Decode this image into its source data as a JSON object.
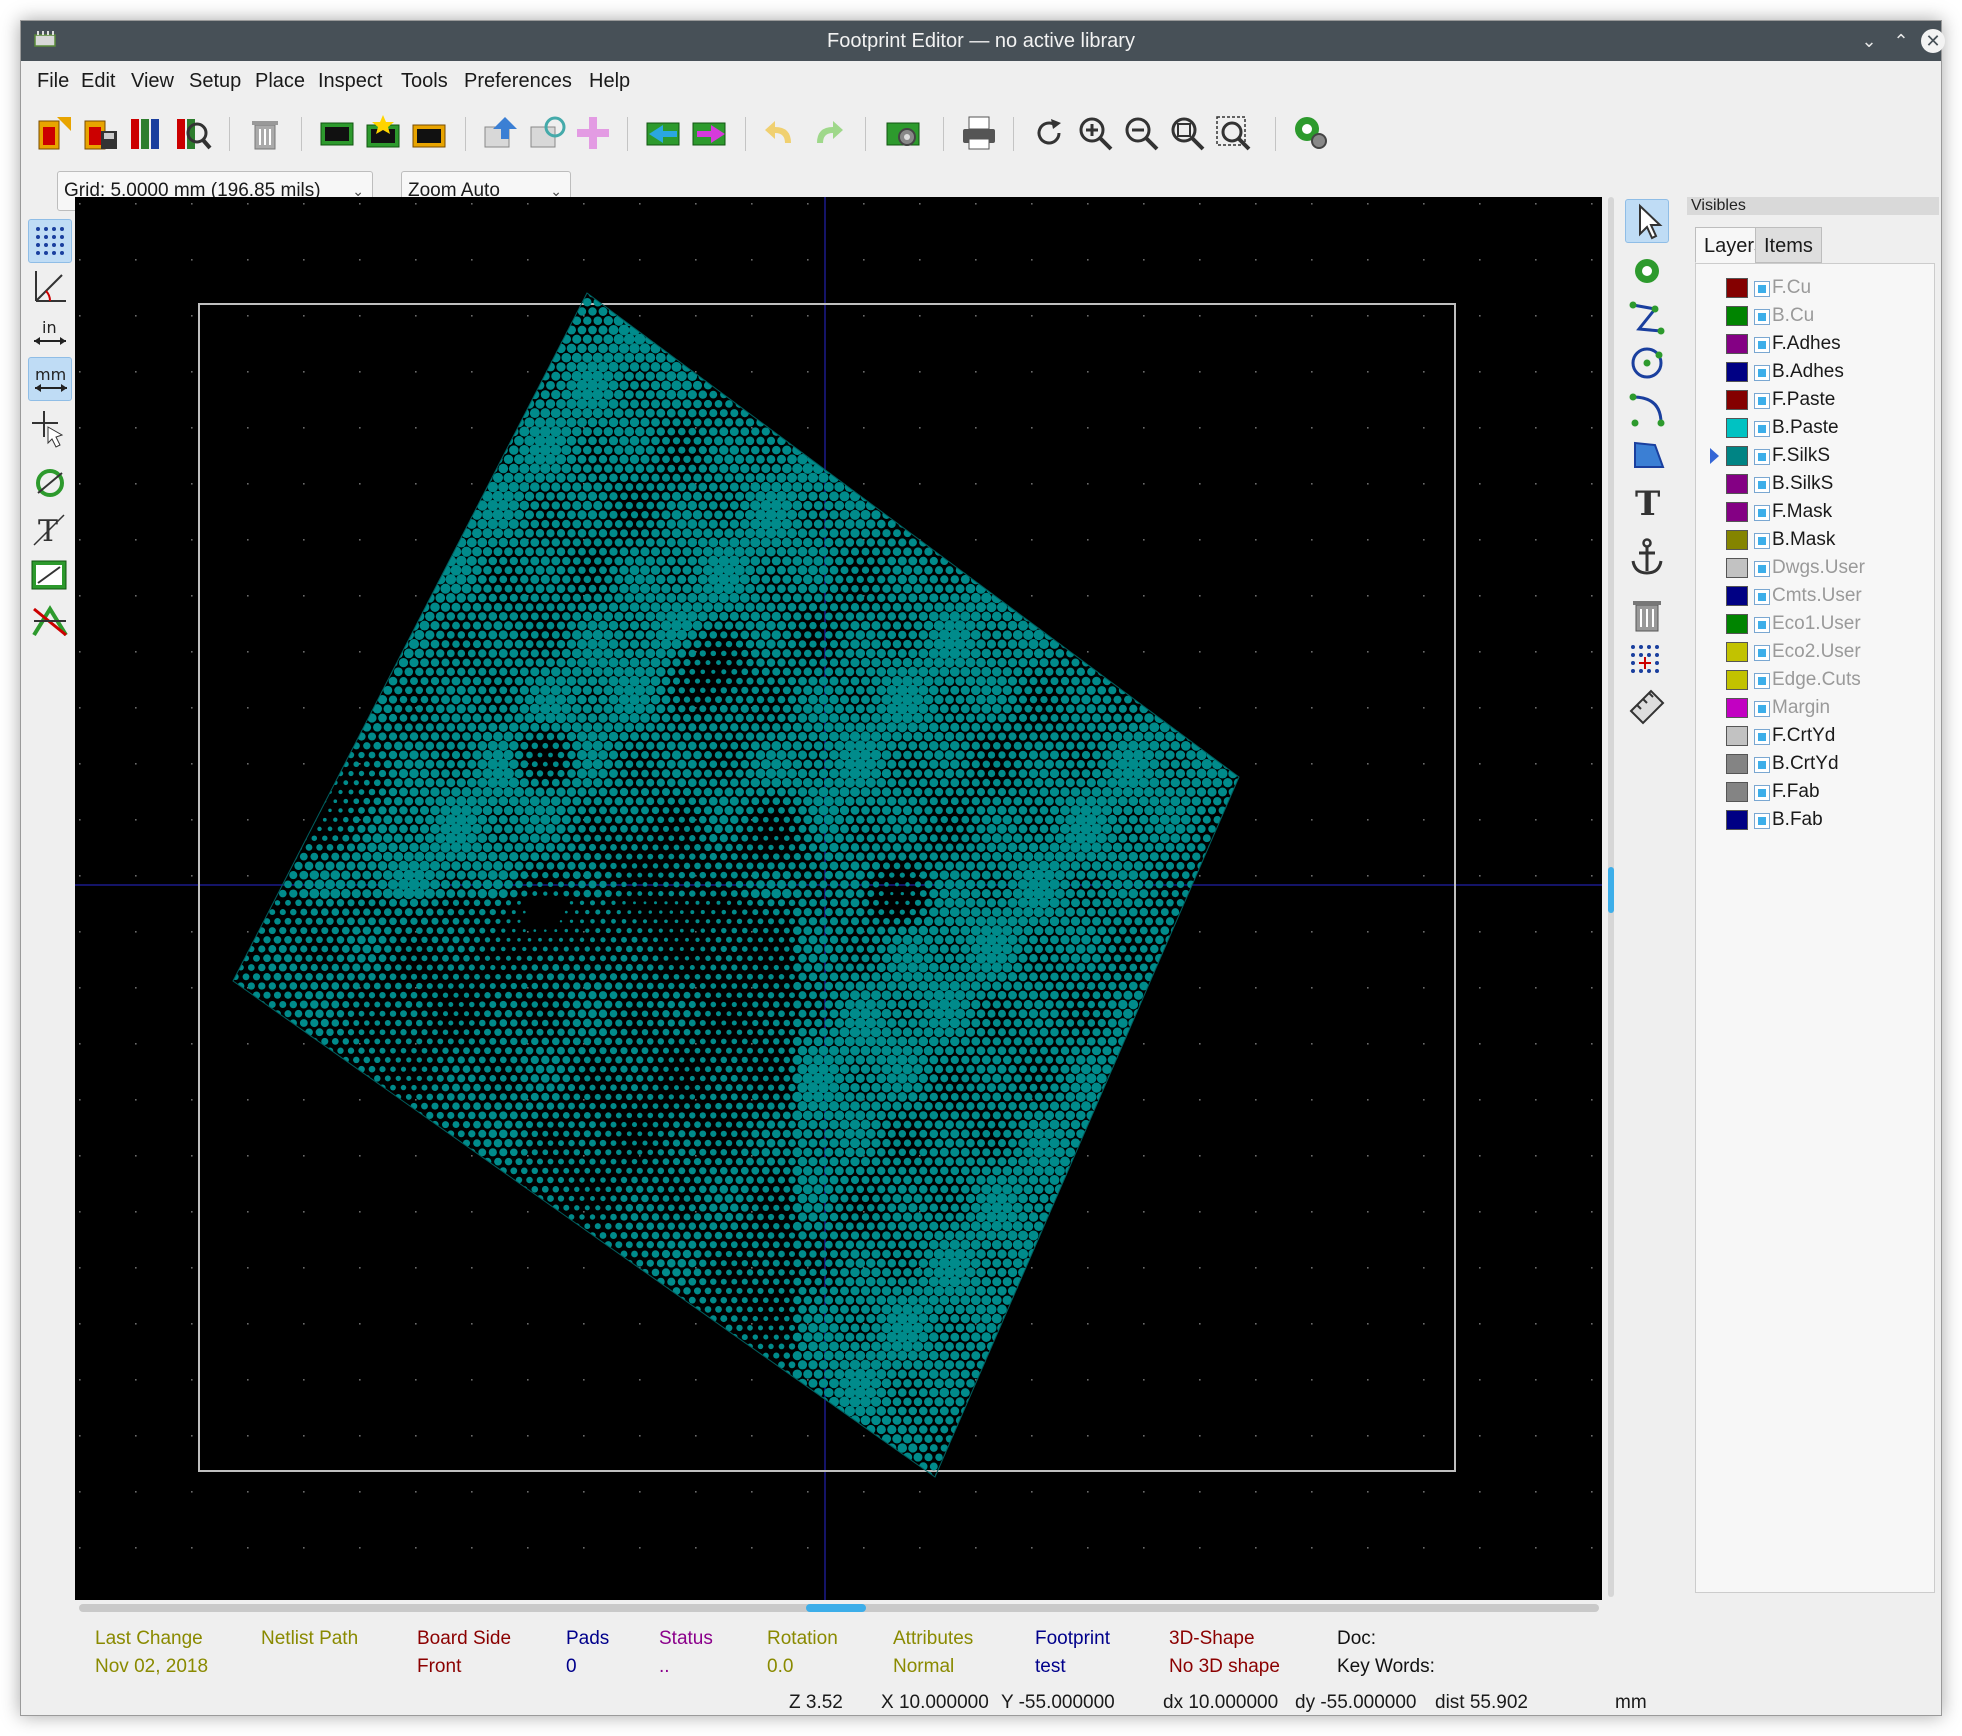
{
  "window": {
    "title": "Footprint Editor — no active library"
  },
  "menubar": {
    "items": [
      "File",
      "Edit",
      "View",
      "Setup",
      "Place",
      "Inspect",
      "Tools",
      "Preferences",
      "Help"
    ]
  },
  "toolbar": {
    "icons": [
      "new-footprint-icon",
      "save-footprint-icon",
      "library-browser-icon",
      "inspect-library-icon",
      "delete-icon",
      "load-from-board-icon",
      "insert-into-board-icon",
      "load-footprint-icon",
      "import-icon",
      "footprint-wizard-icon",
      "add-pad-icon",
      "load-module-icon",
      "update-board-icon",
      "undo-icon",
      "redo-icon",
      "footprint-properties-icon",
      "print-icon",
      "redraw-icon",
      "zoom-in-icon",
      "zoom-out-icon",
      "zoom-fit-icon",
      "zoom-selection-icon",
      "3d-viewer-icon"
    ]
  },
  "toolbar2": {
    "grid_label": "Grid: 5.0000 mm (196.85 mils)",
    "zoom_label": "Zoom Auto"
  },
  "left_toolbar": {
    "icons": [
      "grid-icon",
      "polar-coords-icon",
      "inch-units-icon",
      "mm-units-icon",
      "cursor-shape-icon",
      "pad-sketch-icon",
      "text-sketch-icon",
      "graphic-sketch-icon",
      "high-contrast-icon"
    ]
  },
  "right_toolbar": {
    "icons": [
      "select-arrow-icon",
      "add-pad-icon",
      "add-line-icon",
      "add-circle-icon",
      "add-arc-icon",
      "add-polygon-icon",
      "add-text-icon",
      "anchor-icon",
      "delete-tool-icon",
      "grid-origin-icon",
      "measure-icon"
    ]
  },
  "panel": {
    "title": "Visibles",
    "tabs": [
      "Layers",
      "Items"
    ],
    "layers": [
      {
        "name": "F.Cu",
        "color": "#840000",
        "dim": true
      },
      {
        "name": "B.Cu",
        "color": "#008400",
        "dim": true
      },
      {
        "name": "F.Adhes",
        "color": "#840084",
        "dim": false
      },
      {
        "name": "B.Adhes",
        "color": "#000084",
        "dim": false
      },
      {
        "name": "F.Paste",
        "color": "#840000",
        "dim": false
      },
      {
        "name": "B.Paste",
        "color": "#00c2c2",
        "dim": false
      },
      {
        "name": "F.SilkS",
        "color": "#008484",
        "dim": false,
        "active": true
      },
      {
        "name": "B.SilkS",
        "color": "#840084",
        "dim": false
      },
      {
        "name": "F.Mask",
        "color": "#840084",
        "dim": false
      },
      {
        "name": "B.Mask",
        "color": "#848400",
        "dim": false
      },
      {
        "name": "Dwgs.User",
        "color": "#c2c2c2",
        "dim": true
      },
      {
        "name": "Cmts.User",
        "color": "#000084",
        "dim": true
      },
      {
        "name": "Eco1.User",
        "color": "#008400",
        "dim": true
      },
      {
        "name": "Eco2.User",
        "color": "#c2c200",
        "dim": true
      },
      {
        "name": "Edge.Cuts",
        "color": "#c2c200",
        "dim": true
      },
      {
        "name": "Margin",
        "color": "#c200c2",
        "dim": true
      },
      {
        "name": "F.CrtYd",
        "color": "#c2c2c2",
        "dim": false
      },
      {
        "name": "B.CrtYd",
        "color": "#848484",
        "dim": false
      },
      {
        "name": "F.Fab",
        "color": "#848484",
        "dim": false
      },
      {
        "name": "B.Fab",
        "color": "#000084",
        "dim": false
      }
    ]
  },
  "status": {
    "last_change_label": "Last Change",
    "last_change_value": "Nov 02, 2018",
    "netlist_path_label": "Netlist Path",
    "board_side_label": "Board Side",
    "board_side_value": "Front",
    "pads_label": "Pads",
    "pads_value": "0",
    "status_label": "Status",
    "status_value": "..",
    "rotation_label": "Rotation",
    "rotation_value": "0.0",
    "attributes_label": "Attributes",
    "attributes_value": "Normal",
    "footprint_label": "Footprint",
    "footprint_value": "test",
    "shape_label": "3D-Shape",
    "shape_value": "No 3D shape",
    "doc_label": "Doc:",
    "keywords_label": "Key Words:",
    "colors": {
      "olive": "#8a8a00",
      "darkred": "#8b0000",
      "navy": "#00008b",
      "purple": "#8b008b"
    }
  },
  "coords": {
    "zoom": "Z 3.52",
    "x": "X 10.000000",
    "y": "Y -55.000000",
    "dx": "dx 10.000000",
    "dy": "dy -55.000000",
    "dist": "dist 55.902",
    "units": "mm"
  },
  "canvas": {
    "pad_color": "#008b8b",
    "background": "#000000"
  }
}
